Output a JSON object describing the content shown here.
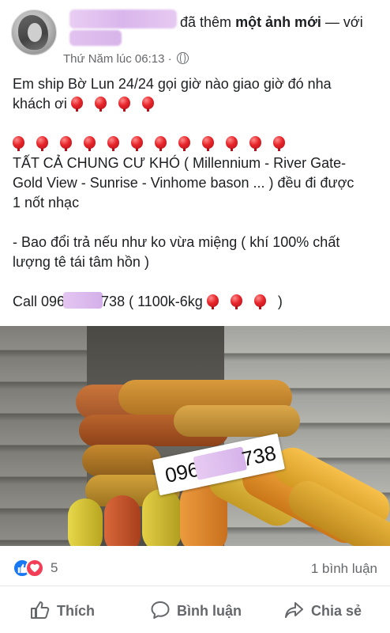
{
  "post": {
    "author_action": "đã thêm",
    "action_bold": "một ảnh mới",
    "action_suffix": "— với",
    "timestamp": "Thứ Năm lúc 06:13 ·",
    "lines": [
      "Em ship Bờ Lun 24/24 gọi giờ nào giao giờ đó nha",
      "khách ơi",
      "TẤT CẢ CHUNG CƯ KHÓ ( Millennium - River Gate-",
      "Gold View - Sunrise - Vinhome bason ... ) đều đi được",
      "1 nốt nhạc",
      "- Bao đổi trả nếu như ko vừa miệng ( khí 100% chất",
      "lượng tê tái tâm hồn )"
    ],
    "call_prefix": "Call 096",
    "call_suffix": "738 ( 1100k-6kg",
    "call_end": ")"
  },
  "photo": {
    "sign_prefix": "096",
    "sign_suffix": "738"
  },
  "stats": {
    "reaction_count": "5",
    "comment_count": "1 bình luận"
  },
  "actions": {
    "like": "Thích",
    "comment": "Bình luận",
    "share": "Chia sẻ"
  },
  "colors": {
    "like_blue": "#1877f2",
    "heart_red": "#f33e58",
    "balloon_red": "#e6252a",
    "redaction": "#ddbdee"
  }
}
